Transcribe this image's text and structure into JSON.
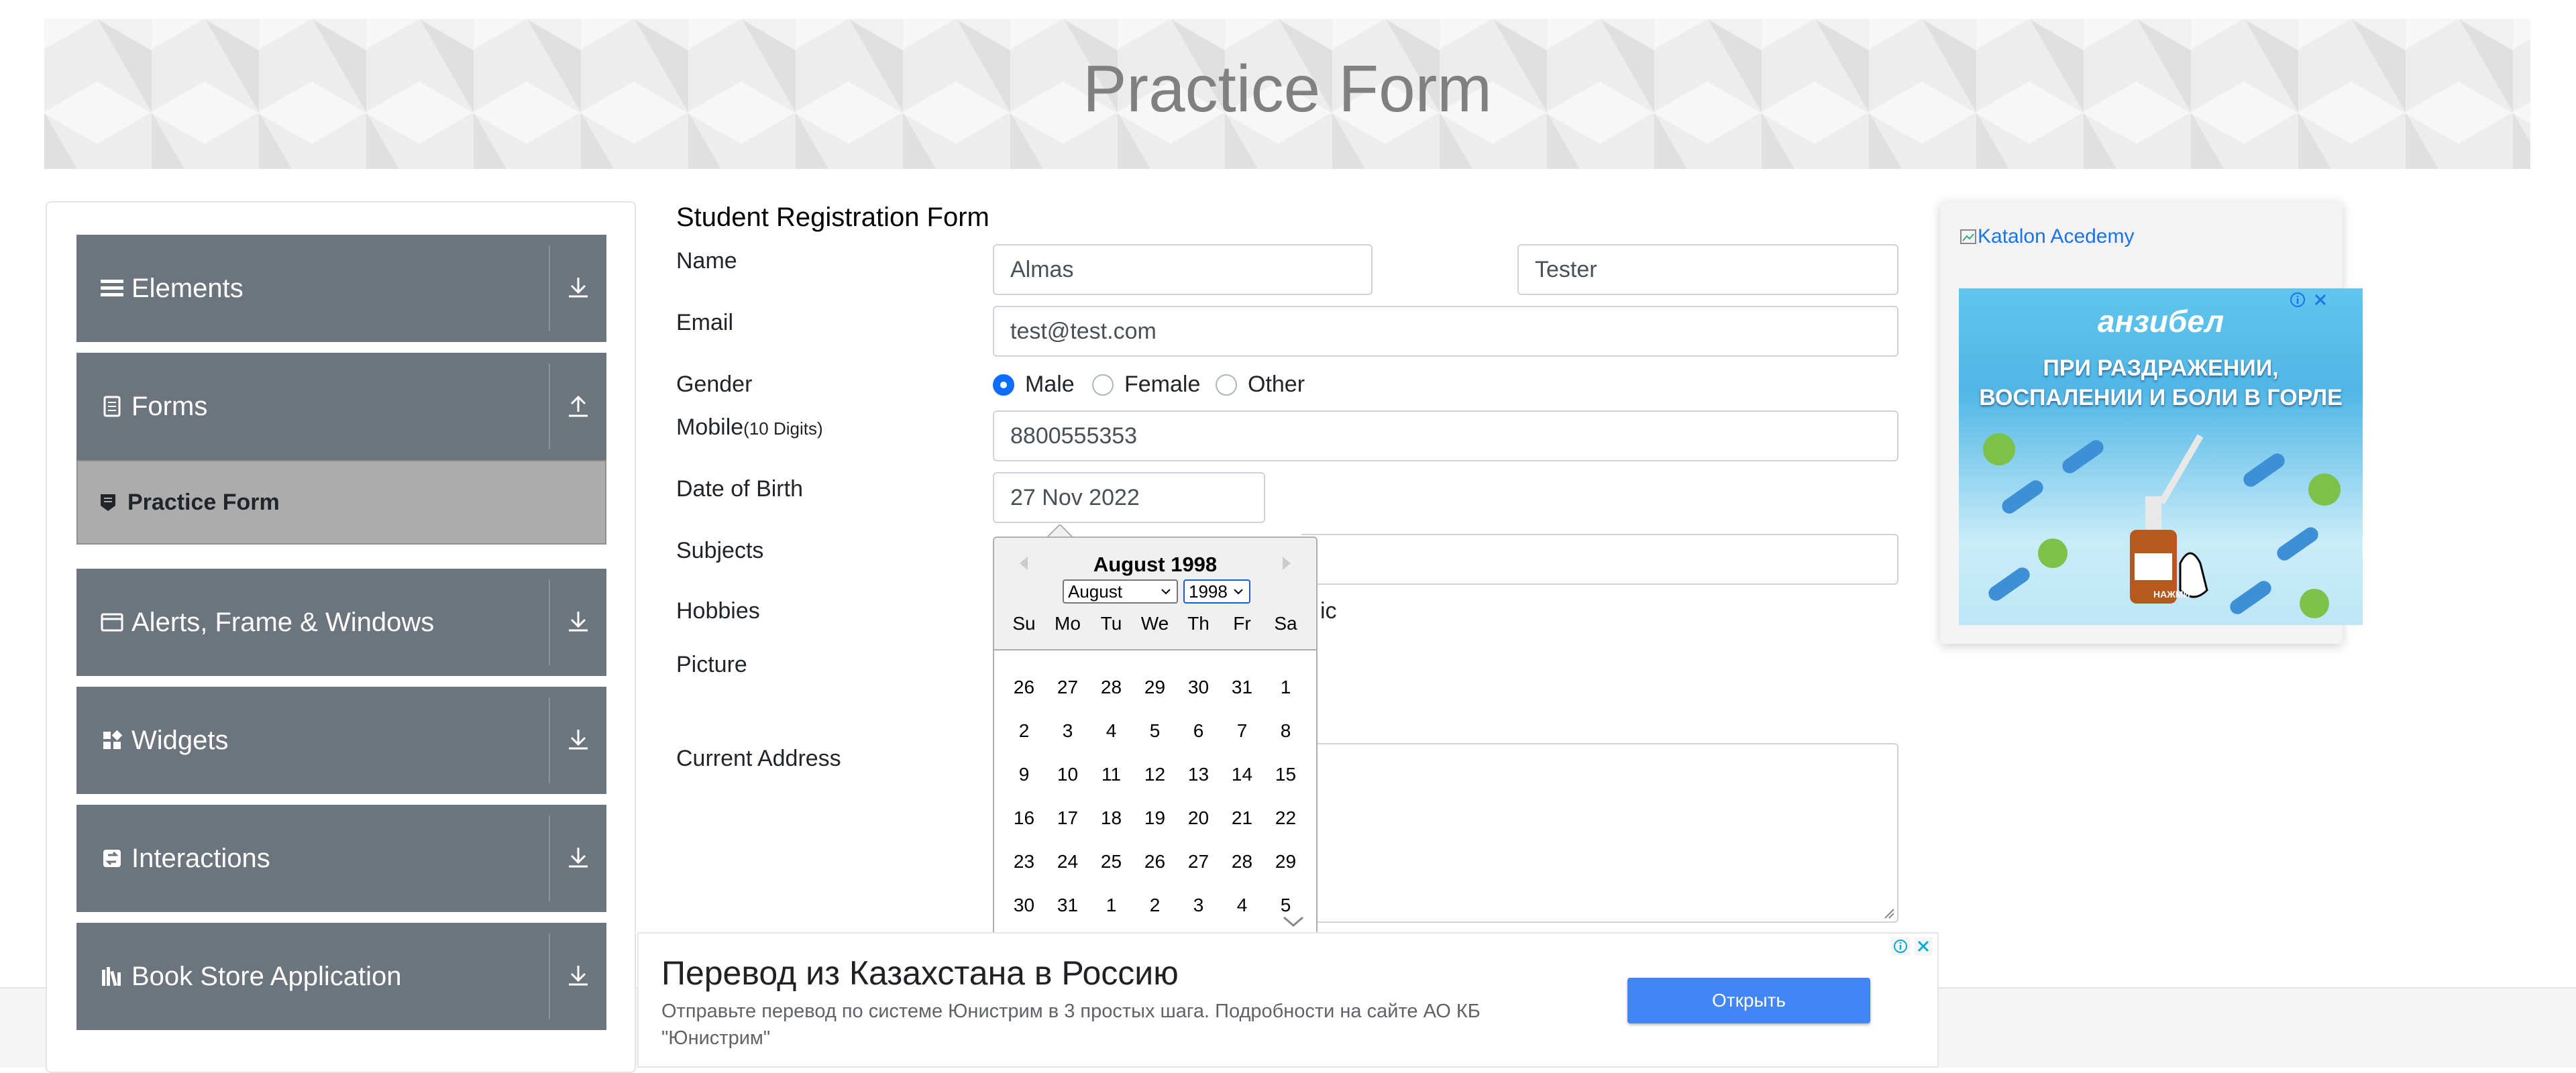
{
  "banner": {
    "title": "Practice Form"
  },
  "sidebar": {
    "groups": [
      {
        "label": "Elements",
        "icon": "menu-icon"
      },
      {
        "label": "Forms",
        "icon": "document-icon"
      },
      {
        "label": "Alerts, Frame & Windows",
        "icon": "window-icon"
      },
      {
        "label": "Widgets",
        "icon": "widgets-icon"
      },
      {
        "label": "Interactions",
        "icon": "interactions-icon"
      },
      {
        "label": "Book Store Application",
        "icon": "books-icon"
      }
    ],
    "active_item": "Practice Form"
  },
  "form": {
    "title": "Student Registration Form",
    "labels": {
      "name": "Name",
      "email": "Email",
      "gender": "Gender",
      "mobile": "Mobile",
      "mobile_hint": "(10 Digits)",
      "dob": "Date of Birth",
      "subjects": "Subjects",
      "hobbies": "Hobbies",
      "picture": "Picture",
      "address": "Current Address"
    },
    "first_name": "Almas",
    "last_name": "Tester",
    "email": "test@test.com",
    "gender_options": [
      "Male",
      "Female",
      "Other"
    ],
    "gender_selected": "Male",
    "mobile": "8800555353",
    "dob": "27 Nov 2022",
    "hobbies_partial": "ic"
  },
  "datepicker": {
    "header": "August 1998",
    "month_select": "August",
    "year_select": "1998",
    "weekdays": [
      "Su",
      "Mo",
      "Tu",
      "We",
      "Th",
      "Fr",
      "Sa"
    ],
    "weeks": [
      [
        "26",
        "27",
        "28",
        "29",
        "30",
        "31",
        "1"
      ],
      [
        "2",
        "3",
        "4",
        "5",
        "6",
        "7",
        "8"
      ],
      [
        "9",
        "10",
        "11",
        "12",
        "13",
        "14",
        "15"
      ],
      [
        "16",
        "17",
        "18",
        "19",
        "20",
        "21",
        "22"
      ],
      [
        "23",
        "24",
        "25",
        "26",
        "27",
        "28",
        "29"
      ],
      [
        "30",
        "31",
        "1",
        "2",
        "3",
        "4",
        "5"
      ]
    ]
  },
  "ad_right": {
    "link_text": "Katalon Acedemy",
    "brand": "анзибел",
    "line1": "ПРИ РАЗДРАЖЕНИИ,",
    "line2": "ВОСПАЛЕНИИ И БОЛИ В ГОРЛЕ",
    "cta": "НАЖМИ"
  },
  "ad_bottom": {
    "title": "Перевод из Казахстана в Россию",
    "description": "Отправьте перевод по системе Юнистрим в 3 простых шага. Подробности на сайте АО КБ \"Юнистрим\"",
    "button": "Открыть"
  },
  "colors": {
    "sidebar_group": "#6c757d",
    "active_item": "#acacac",
    "primary": "#0d6efd",
    "ad_button": "#4285f4"
  }
}
